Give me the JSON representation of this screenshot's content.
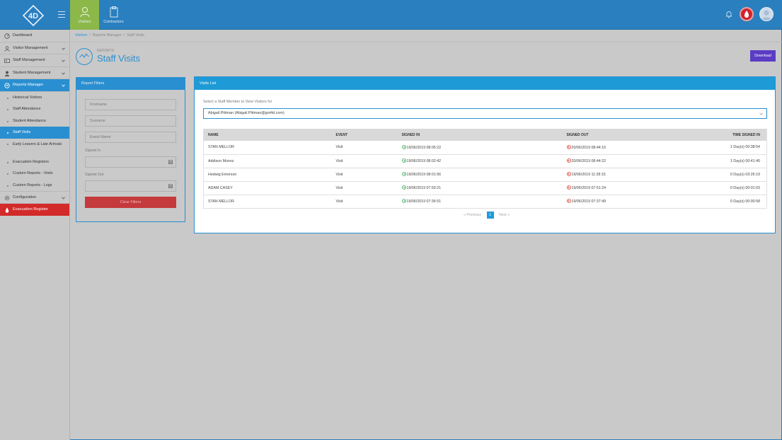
{
  "topbar": {
    "tabs": [
      {
        "label": "Visitors",
        "icon": "user-icon"
      },
      {
        "label": "Contractors",
        "icon": "clipboard-icon"
      }
    ]
  },
  "sidebar": {
    "items": [
      {
        "label": "Dashboard",
        "icon": "dashboard-icon"
      },
      {
        "label": "Visitor Management",
        "icon": "user-icon"
      },
      {
        "label": "Staff Management",
        "icon": "id-card-icon"
      },
      {
        "label": "Student Management",
        "icon": "student-icon"
      },
      {
        "label": "Reports Manager",
        "icon": "reports-icon"
      }
    ],
    "sub_items": [
      "Historical Visitors",
      "Staff Attendance",
      "Student Attendance",
      "Staff Visits",
      "Early Leavers & Late Arrivals",
      "Evacuation Registers",
      "Custom Reports - Visits",
      "Custom Reports - Logs"
    ],
    "configuration": "Configuration",
    "evacuation": "Evacuation Register"
  },
  "breadcrumb": [
    "Visitors",
    "Reports Manager",
    "Staff Visits"
  ],
  "header": {
    "supertitle": "REPORTS",
    "title": "Staff Visits",
    "download_label": "Download"
  },
  "filters": {
    "title": "Report Filters",
    "firstname_placeholder": "Firstname",
    "surname_placeholder": "Surname",
    "event_placeholder": "Event Name",
    "signed_in_label": "Signed In",
    "signed_out_label": "Signed Out",
    "clear_label": "Clear Filters"
  },
  "visits": {
    "title": "Visits List",
    "select_label": "Select a Staff Member to View Visitors for",
    "selected_staff": "Abigail.Pittman (Abigail.Pittman@got4d.com)",
    "columns": [
      "NAME",
      "EVENT",
      "SIGNED IN",
      "SIGNED OUT",
      "TIME SIGNED IN"
    ],
    "rows": [
      {
        "name": "STAN MELLOR",
        "event": "Visit",
        "signed_in": "19/06/2019 08:05:22",
        "signed_out": "20/06/2019 08:44:16",
        "duration": "1 Day(s) 00:38:54"
      },
      {
        "name": "Addison Munoz",
        "event": "Visit",
        "signed_in": "19/06/2019 08:02:42",
        "signed_out": "20/06/2019 08:44:22",
        "duration": "1 Day(s) 00:41:40"
      },
      {
        "name": "Hedwig Emerson",
        "event": "Visit",
        "signed_in": "19/06/2019 08:01:56",
        "signed_out": "19/06/2019 11:28:15",
        "duration": "0 Day(s) 03:26:19"
      },
      {
        "name": "ADAM CASEY",
        "event": "Visit",
        "signed_in": "19/06/2019 07:50:21",
        "signed_out": "19/06/2019 07:51:24",
        "duration": "0 Day(s) 00:01:03"
      },
      {
        "name": "STAN MELLOR",
        "event": "Visit",
        "signed_in": "19/06/2019 07:36:51",
        "signed_out": "19/06/2019 07:37:49",
        "duration": "0 Day(s) 00:00:58"
      }
    ],
    "pager": {
      "previous": "« Previous",
      "current": "1",
      "next": "Next »"
    }
  },
  "colors": {
    "brand_blue": "#2a8fd0",
    "visitors_tab": "#8cb84a",
    "download": "#5b3cc4",
    "danger": "#d32a2a"
  }
}
